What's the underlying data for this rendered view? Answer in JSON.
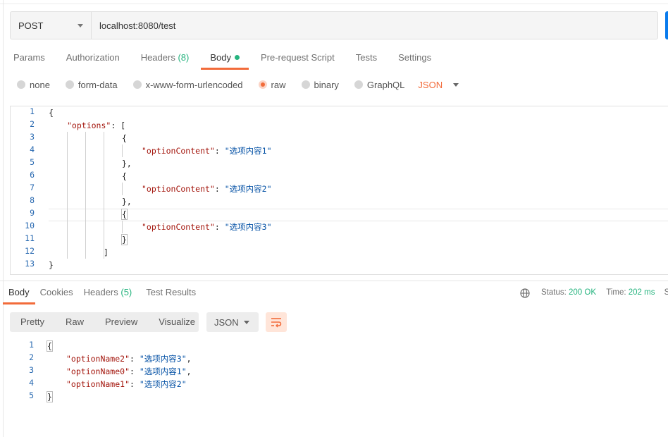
{
  "request": {
    "method": "POST",
    "url": "localhost:8080/test"
  },
  "request_tabs": {
    "params": "Params",
    "authorization": "Authorization",
    "headers": "Headers",
    "headers_count": "(8)",
    "body": "Body",
    "pre_request": "Pre-request Script",
    "tests": "Tests",
    "settings": "Settings"
  },
  "body_types": {
    "none": "none",
    "form_data": "form-data",
    "urlencoded": "x-www-form-urlencoded",
    "raw": "raw",
    "binary": "binary",
    "graphql": "GraphQL",
    "language": "JSON",
    "selected": "raw"
  },
  "request_body": {
    "line_numbers": [
      "1",
      "2",
      "3",
      "4",
      "5",
      "6",
      "7",
      "8",
      "9",
      "10",
      "11",
      "12",
      "13"
    ],
    "open_brace": "{",
    "options_key": "\"options\"",
    "colon_bracket": ": [",
    "item_open": "{",
    "item_close_comma": "},",
    "item_close": "}",
    "option_key": "\"optionContent\"",
    "colon": ": ",
    "values": [
      "\"选项内容1\"",
      "\"选项内容2\"",
      "\"选项内容3\""
    ],
    "array_close": "]",
    "close_brace": "}"
  },
  "response_tabs": {
    "body": "Body",
    "cookies": "Cookies",
    "headers": "Headers",
    "headers_count": "(5)",
    "test_results": "Test Results"
  },
  "status": {
    "status_label": "Status:",
    "status_value": "200 OK",
    "time_label": "Time:",
    "time_value": "202 ms",
    "size_label": "S"
  },
  "response_toolbar": {
    "pretty": "Pretty",
    "raw": "Raw",
    "preview": "Preview",
    "visualize": "Visualize",
    "format": "JSON"
  },
  "response_body": {
    "line_numbers": [
      "1",
      "2",
      "3",
      "4",
      "5"
    ],
    "open_brace": "{",
    "entries": [
      {
        "key": "\"optionName2\"",
        "value": "\"选项内容3\"",
        "sep": ","
      },
      {
        "key": "\"optionName0\"",
        "value": "\"选项内容1\"",
        "sep": ","
      },
      {
        "key": "\"optionName1\"",
        "value": "\"选项内容2\"",
        "sep": ""
      }
    ],
    "close_brace": "}"
  },
  "colors": {
    "accent": "#f26b3a",
    "success": "#26b47f",
    "send_button": "#097bed",
    "json_key": "#a3150c",
    "json_string": "#0451a5"
  },
  "icons": [
    "caret-down-icon",
    "status-dot-icon",
    "globe-icon",
    "wrap-lines-icon"
  ]
}
